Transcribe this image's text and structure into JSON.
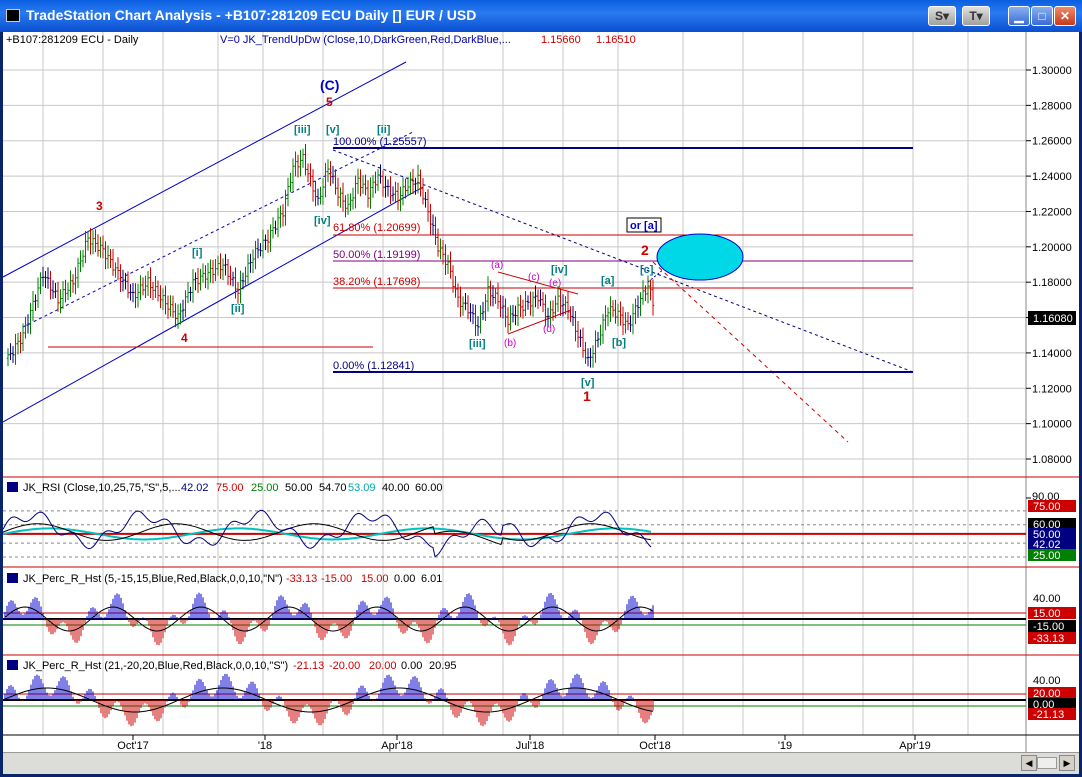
{
  "window": {
    "title": "TradeStation Chart Analysis - +B107:281209 ECU Daily [] EUR / USD",
    "buttons": {
      "s": "S",
      "t": "T"
    }
  },
  "header": {
    "symbol": "+B107:281209 ECU - Daily",
    "indicator": "V=0  JK_TrendUpDw (Close,10,DarkGreen,Red,DarkBlue,...",
    "v1": "1.15660",
    "v2": "1.16510"
  },
  "price_axis": {
    "ticks": [
      "1.30000",
      "1.28000",
      "1.26000",
      "1.24000",
      "1.22000",
      "1.20000",
      "1.18000",
      "1.16000",
      "1.14000",
      "1.12000",
      "1.10000",
      "1.08000"
    ],
    "last_price": "1.16080"
  },
  "fib_levels": {
    "f100": "100.00% (1.25557)",
    "f61": "61.80% (1.20699)",
    "f50": "50.00% (1.19199)",
    "f38": "38.20% (1.17698)",
    "f0": "0.00% (1.12841)"
  },
  "wave_labels": {
    "C": "(C)",
    "w5": "5",
    "w3": "3",
    "w4": "4",
    "iii_top": "[iii]",
    "v_top": "[v]",
    "ii_top": "[ii]",
    "i": "[i]",
    "ii": "[ii]",
    "iv": "[iv]",
    "iii_mid": "[iii]",
    "a": "(a)",
    "b": "(b)",
    "c": "(c)",
    "d": "(d)",
    "e": "(e)",
    "iv_mid": "[iv]",
    "v_low": "[v]",
    "w1": "1",
    "a_br": "[a]",
    "b_br": "[b]",
    "w2": "2",
    "c_br": "[c]",
    "or_a": "or [a]"
  },
  "date_axis": [
    "Oct'17",
    "'18",
    "Apr'18",
    "Jul'18",
    "Oct'18",
    "'19",
    "Apr'19"
  ],
  "rsi": {
    "label": "JK_RSI (Close,10,25,75,\"S\",5,...",
    "v1": "42.02",
    "v2": "75.00",
    "v3": "25.00",
    "v4": "50.00",
    "v5": "54.70",
    "v6": "53.09",
    "v7": "40.00",
    "v8": "60.00",
    "axis": [
      "75.00",
      "60.00",
      "50.00",
      "42.02",
      "25.00"
    ],
    "tick90": "90.00"
  },
  "perc1": {
    "label": "JK_Perc_R_Hst (5,-15,15,Blue,Red,Black,0,0,10,\"N\")",
    "v1": "-33.13",
    "v2": "-15.00",
    "v3": "15.00",
    "v4": "0.00",
    "v5": "6.01",
    "axis": [
      "40.00",
      "15.00",
      "-15.00",
      "-33.13"
    ]
  },
  "perc2": {
    "label": "JK_Perc_R_Hst (21,-20,20,Blue,Red,Black,0,0,10,\"S\")",
    "v1": "-21.13",
    "v2": "-20.00",
    "v3": "20.00",
    "v4": "0.00",
    "v5": "20.95",
    "axis": [
      "40.00",
      "20.00",
      "0.00",
      "-21.13"
    ]
  },
  "colors": {
    "up_bar": "#008000",
    "down_bar": "#cc0000",
    "neutral_bar": "#000080",
    "fib_line": "#000080",
    "fib_red": "#cc0000",
    "wave_red": "#cc0000",
    "wave_blue": "#0000cc",
    "wave_teal": "#008080",
    "wave_magenta": "#cc00cc",
    "ellipse": "#00d0e0"
  }
}
